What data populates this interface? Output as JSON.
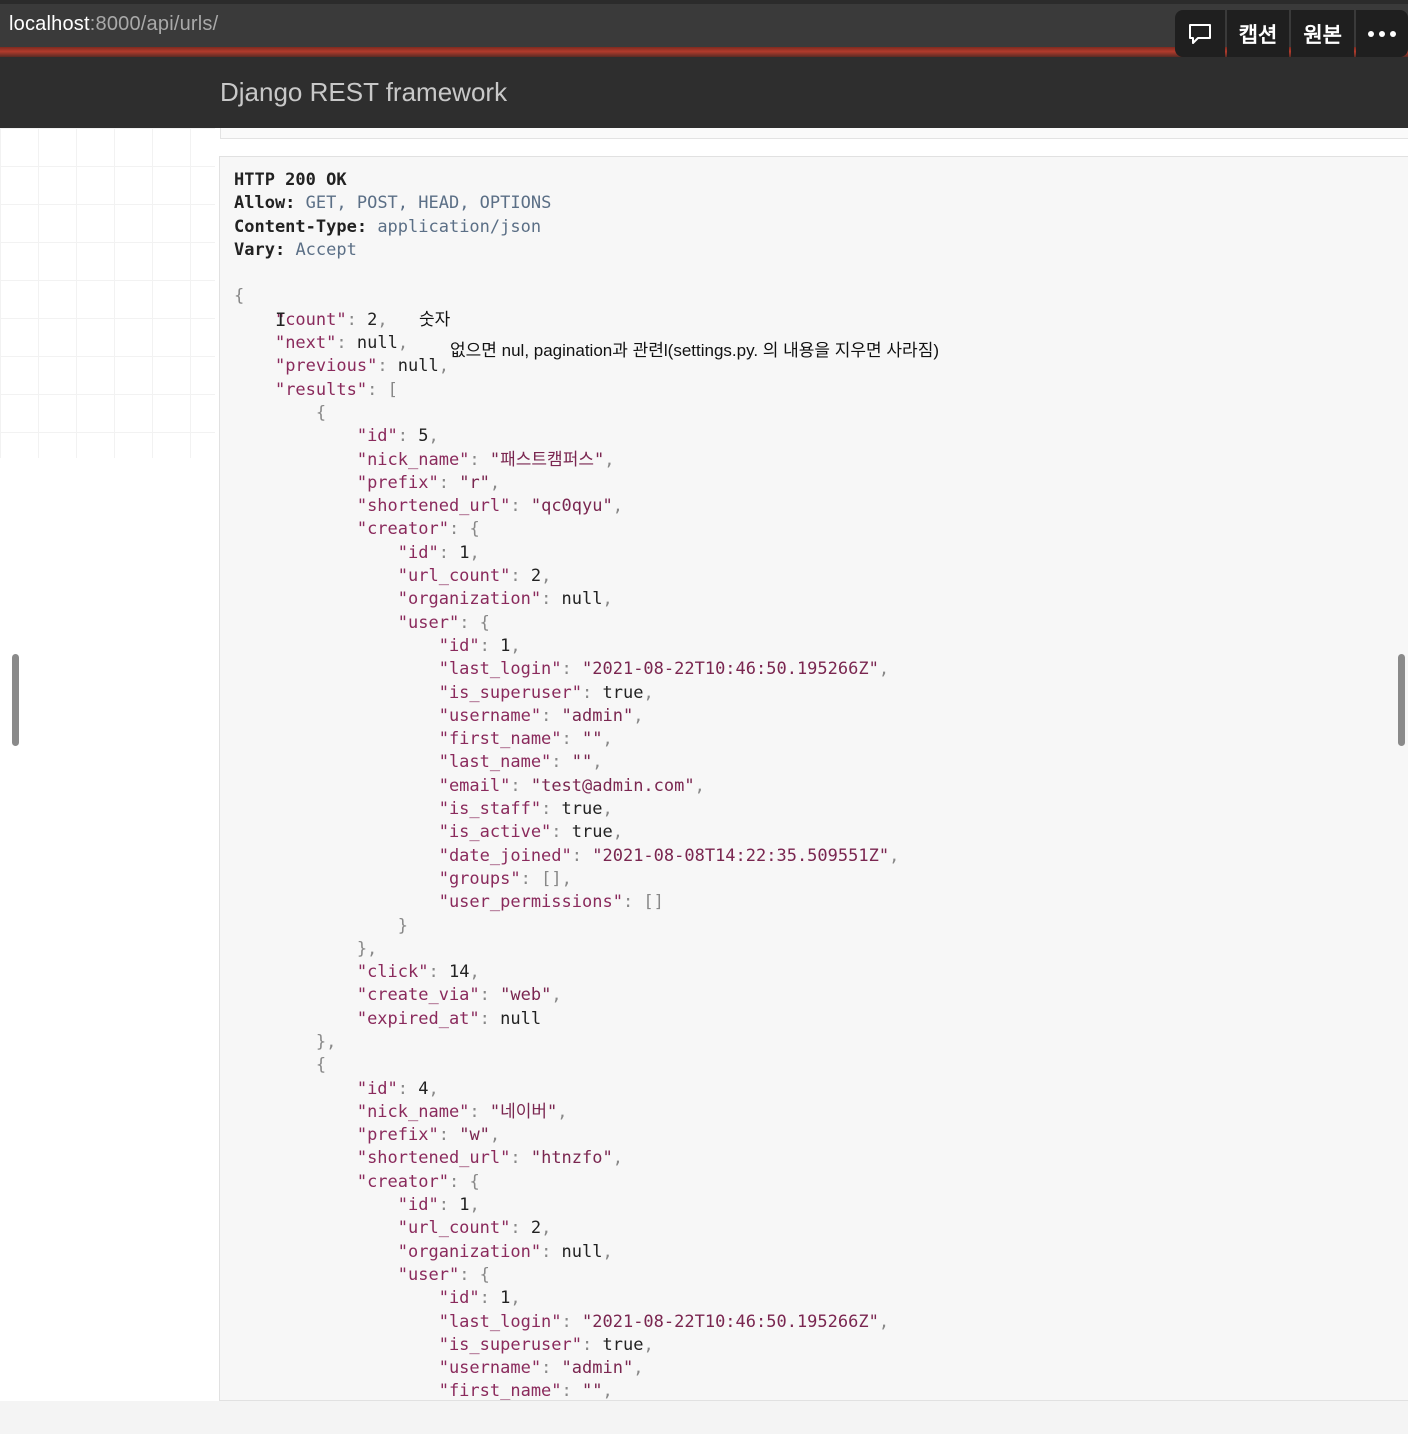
{
  "address_bar": {
    "host": "localhost",
    "path": ":8000/api/urls/"
  },
  "overlay": {
    "comment_icon": "speech-bubble-icon",
    "caption_label": "캡션",
    "original_label": "원본",
    "more_icon": "more-dots-icon"
  },
  "navbar": {
    "brand": "Django REST framework"
  },
  "response": {
    "status": "HTTP 200 OK",
    "headers": [
      {
        "key": "Allow:",
        "value": "GET, POST, HEAD, OPTIONS"
      },
      {
        "key": "Content-Type:",
        "value": "application/json"
      },
      {
        "key": "Vary:",
        "value": "Accept"
      }
    ]
  },
  "notes": {
    "count_note": "숫자",
    "next_note": "없으면 nul, pagination과 관련l(settings.py.  의 내용을 지우면 사라짐)"
  },
  "json_lines": [
    "{",
    "    \"count\": 2,",
    "    \"next\": null,",
    "    \"previous\": null,",
    "    \"results\": [",
    "        {",
    "            \"id\": 5,",
    "            \"nick_name\": \"패스트캠퍼스\",",
    "            \"prefix\": \"r\",",
    "            \"shortened_url\": \"qc0qyu\",",
    "            \"creator\": {",
    "                \"id\": 1,",
    "                \"url_count\": 2,",
    "                \"organization\": null,",
    "                \"user\": {",
    "                    \"id\": 1,",
    "                    \"last_login\": \"2021-08-22T10:46:50.195266Z\",",
    "                    \"is_superuser\": true,",
    "                    \"username\": \"admin\",",
    "                    \"first_name\": \"\",",
    "                    \"last_name\": \"\",",
    "                    \"email\": \"test@admin.com\",",
    "                    \"is_staff\": true,",
    "                    \"is_active\": true,",
    "                    \"date_joined\": \"2021-08-08T14:22:35.509551Z\",",
    "                    \"groups\": [],",
    "                    \"user_permissions\": []",
    "                }",
    "            },",
    "            \"click\": 14,",
    "            \"create_via\": \"web\",",
    "            \"expired_at\": null",
    "        },",
    "        {",
    "            \"id\": 4,",
    "            \"nick_name\": \"네이버\",",
    "            \"prefix\": \"w\",",
    "            \"shortened_url\": \"htnzfo\",",
    "            \"creator\": {",
    "                \"id\": 1,",
    "                \"url_count\": 2,",
    "                \"organization\": null,",
    "                \"user\": {",
    "                    \"id\": 1,",
    "                    \"last_login\": \"2021-08-22T10:46:50.195266Z\",",
    "                    \"is_superuser\": true,",
    "                    \"username\": \"admin\",",
    "                    \"first_name\": \"\","
  ]
}
